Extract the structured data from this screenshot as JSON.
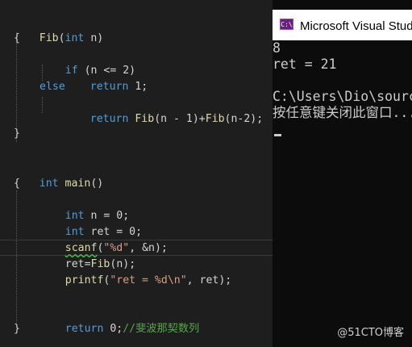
{
  "editor": {
    "lines": {
      "fib_sig": {
        "name": "Fib",
        "paren_open": "(",
        "type": "int",
        "param": " n)"
      },
      "brace1": "{",
      "if_line": {
        "kw": "if",
        "rest": " (n <= 2)"
      },
      "return1": {
        "kw": "return",
        "rest": " 1;"
      },
      "else": "else",
      "return2": {
        "kw": "return",
        "fn1": "Fib",
        "mid": "(n - 1)+",
        "fn2": "Fib",
        "end": "(n-2);"
      },
      "brace2": "}",
      "main_sig": {
        "type": "int",
        "name": "main",
        "rest": "()"
      },
      "brace3": "{",
      "decl_n": {
        "type": "int",
        "rest": " n = 0;"
      },
      "decl_ret": {
        "type": "int",
        "rest": " ret = 0;"
      },
      "scanf": {
        "fn": "scanf",
        "open": "(",
        "str": "\"%d\"",
        "rest": ", &n);"
      },
      "assign": {
        "lhs": "ret",
        "eq": "=",
        "fn": "Fib",
        "rest": "(n);"
      },
      "printf": {
        "fn": "printf",
        "open": "(",
        "str": "\"ret = %d\\n\"",
        "rest": ", ret);"
      },
      "return0": {
        "kw": "return",
        "rest": " 0;",
        "comment": "//斐波那契数列"
      },
      "brace4": "}"
    }
  },
  "console": {
    "title": "Microsoft Visual Studio 调试控制台",
    "logo_text": "C:\\",
    "output": [
      "8",
      "ret = 21",
      "",
      "C:\\Users\\Dio\\source\\repos",
      "按任意键关闭此窗口..."
    ]
  },
  "watermark": "@51CTO博客"
}
